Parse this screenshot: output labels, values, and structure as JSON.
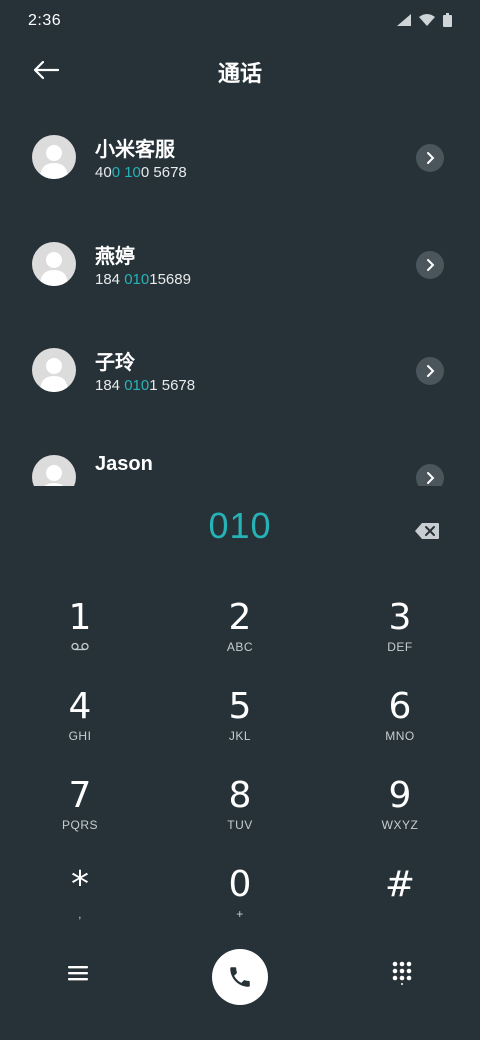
{
  "status": {
    "time": "2:36"
  },
  "header": {
    "title": "通话"
  },
  "contacts": [
    {
      "name": "小米客服",
      "number_parts": [
        {
          "t": "40",
          "h": false
        },
        {
          "t": "0",
          "h": true
        },
        {
          "t": " ",
          "h": false
        },
        {
          "t": "10",
          "h": true
        },
        {
          "t": "0 5678",
          "h": false
        }
      ]
    },
    {
      "name": "燕婷",
      "number_parts": [
        {
          "t": "184 ",
          "h": false
        },
        {
          "t": "010",
          "h": true
        },
        {
          "t": "15689",
          "h": false
        }
      ]
    },
    {
      "name": "子玲",
      "number_parts": [
        {
          "t": "184 ",
          "h": false
        },
        {
          "t": "010",
          "h": true
        },
        {
          "t": "1 5678",
          "h": false
        }
      ]
    },
    {
      "name": "Jason",
      "number_parts": []
    }
  ],
  "dialer": {
    "input": "010",
    "keys": [
      {
        "digit": "1",
        "letters": ""
      },
      {
        "digit": "2",
        "letters": "ABC"
      },
      {
        "digit": "3",
        "letters": "DEF"
      },
      {
        "digit": "4",
        "letters": "GHI"
      },
      {
        "digit": "5",
        "letters": "JKL"
      },
      {
        "digit": "6",
        "letters": "MNO"
      },
      {
        "digit": "7",
        "letters": "PQRS"
      },
      {
        "digit": "8",
        "letters": "TUV"
      },
      {
        "digit": "9",
        "letters": "WXYZ"
      },
      {
        "digit": "*",
        "letters": ","
      },
      {
        "digit": "0",
        "letters": "+"
      },
      {
        "digit": "#",
        "letters": ""
      }
    ]
  },
  "colors": {
    "background": "#263238",
    "accent": "#27b3b6"
  },
  "icons": {
    "back": "arrow-left-icon",
    "chevron": "chevron-right-icon",
    "backspace": "backspace-icon",
    "menu": "menu-icon",
    "call": "phone-icon",
    "dialpad": "dialpad-icon",
    "voicemail": "voicemail-icon"
  }
}
